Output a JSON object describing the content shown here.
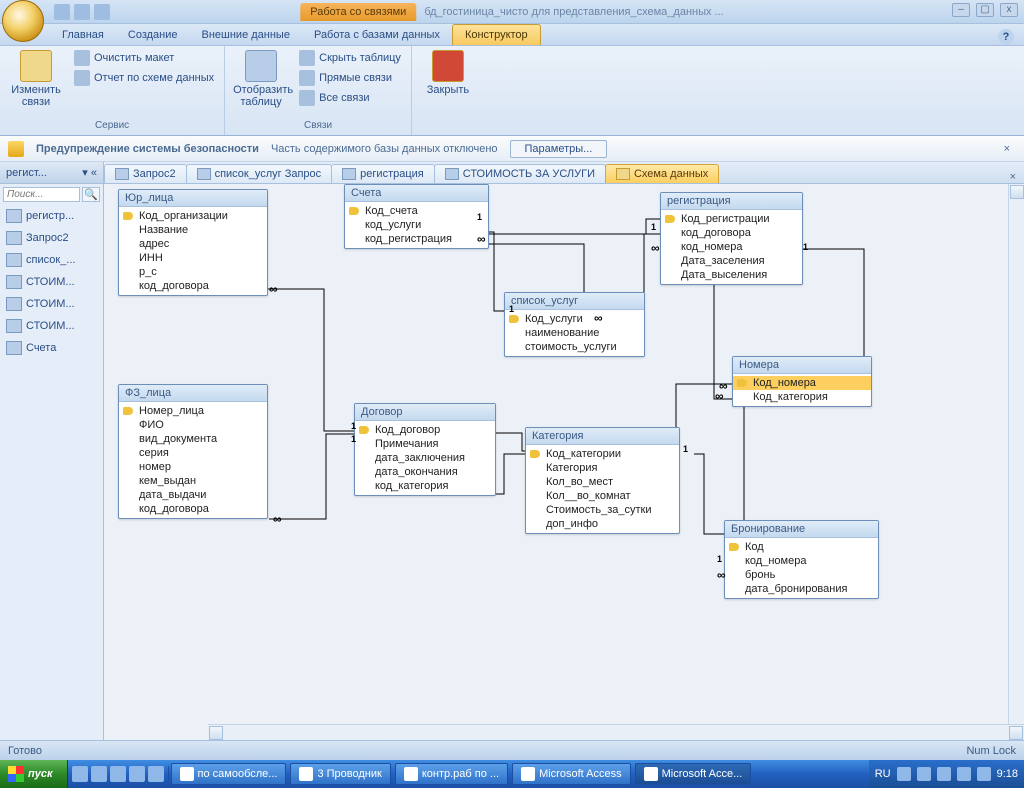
{
  "title": {
    "context_tab": "Работа со связями",
    "app_title": "бд_гостиница_чисто для представления_схема_данных ..."
  },
  "ribbon_tabs": [
    "Главная",
    "Создание",
    "Внешние данные",
    "Работа с базами данных",
    "Конструктор"
  ],
  "ribbon": {
    "group_service": "Сервис",
    "btn_edit_rel": "Изменить связи",
    "btn_clear": "Очистить макет",
    "btn_report": "Отчет по схеме данных",
    "btn_show_table": "Отобразить таблицу",
    "group_rel": "Связи",
    "btn_hide": "Скрыть таблицу",
    "btn_direct": "Прямые связи",
    "btn_all": "Все связи",
    "btn_close": "Закрыть"
  },
  "security": {
    "title": "Предупреждение системы безопасности",
    "text": "Часть содержимого базы данных отключено",
    "btn": "Параметры..."
  },
  "nav": {
    "header": "регист...",
    "search_placeholder": "Поиск...",
    "items": [
      "регистр...",
      "Запрос2",
      "список_...",
      "СТОИМ...",
      "СТОИМ...",
      "СТОИМ...",
      "Счета"
    ]
  },
  "doc_tabs": [
    {
      "label": "Запрос2"
    },
    {
      "label": "список_услуг Запрос"
    },
    {
      "label": "регистрация"
    },
    {
      "label": "СТОИМОСТЬ ЗА УСЛУГИ"
    },
    {
      "label": "Схема данных"
    }
  ],
  "tables": {
    "yur": {
      "title": "Юр_лица",
      "fields": [
        "Код_организации",
        "Название",
        "адрес",
        "ИНН",
        "р_с",
        "код_договора"
      ],
      "pk": [
        0
      ]
    },
    "fiz": {
      "title": "ФЗ_лица",
      "fields": [
        "Номер_лица",
        "ФИО",
        "вид_документа",
        "серия",
        "номер",
        "кем_выдан",
        "дата_выдачи",
        "код_договора"
      ],
      "pk": [
        0
      ]
    },
    "scheta": {
      "title": "Счета",
      "fields": [
        "Код_счета",
        "код_услуги",
        "код_регистрация"
      ],
      "pk": [
        0
      ]
    },
    "spisok": {
      "title": "список_услуг",
      "fields": [
        "Код_услуги",
        "наименование",
        "стоимость_услуги"
      ],
      "pk": [
        0
      ]
    },
    "dogovor": {
      "title": "Договор",
      "fields": [
        "Код_договор",
        "Примечания",
        "дата_заключения",
        "дата_окончания",
        "код_категория"
      ],
      "pk": [
        0
      ]
    },
    "kategoria": {
      "title": "Категория",
      "fields": [
        "Код_категории",
        "Категория",
        "Кол_во_мест",
        "Кол__во_комнат",
        "Стоимость_за_сутки",
        "доп_инфо"
      ],
      "pk": [
        0
      ]
    },
    "reg": {
      "title": "регистрация",
      "fields": [
        "Код_регистрации",
        "код_договора",
        "код_номера",
        "Дата_заселения",
        "Дата_выселения"
      ],
      "pk": [
        0
      ]
    },
    "nomera": {
      "title": "Номера",
      "fields": [
        "Код_номера",
        "Код_категория"
      ],
      "pk": [
        0
      ],
      "selected": 0
    },
    "bron": {
      "title": "Бронирование",
      "fields": [
        "Код",
        "код_номера",
        "бронь",
        "дата_бронирования"
      ],
      "pk": [
        0
      ]
    }
  },
  "status": {
    "left": "Готово",
    "right": "Num Lock"
  },
  "taskbar": {
    "start": "пуск",
    "items": [
      "по самообсле...",
      "3 Проводник",
      "контр.раб по ...",
      "Microsoft Access",
      "Microsoft Acce..."
    ],
    "lang": "RU",
    "clock": "9:18"
  }
}
